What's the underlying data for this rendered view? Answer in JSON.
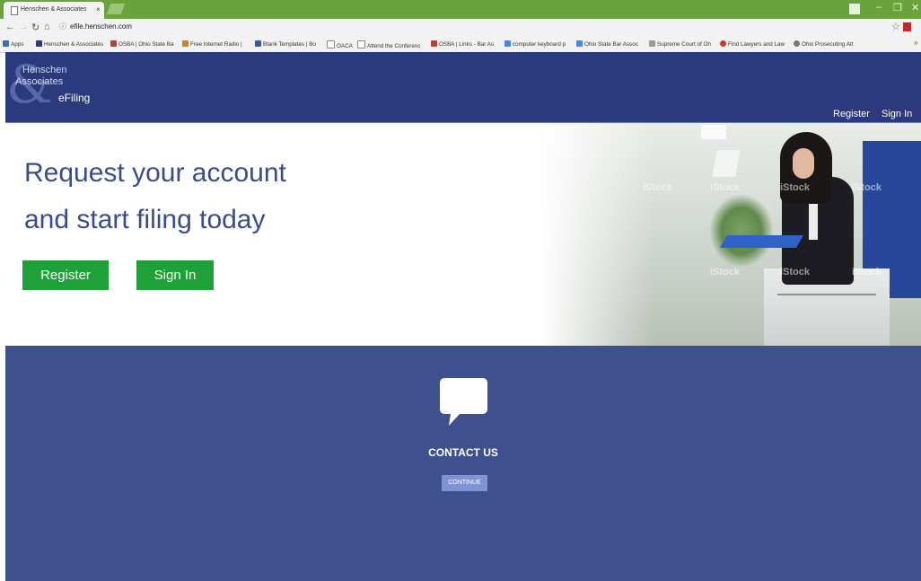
{
  "browser": {
    "tab_title": "Henschen & Associates",
    "tab_close": "×",
    "url": "efile.henschen.com",
    "bookmarks": [
      {
        "label": "Apps",
        "color": "#2d6fd1"
      },
      {
        "label": "Henschen & Associates",
        "color": "#2b3a7c"
      },
      {
        "label": "OSBA | Ohio State Ba",
        "color": "#c23b2f"
      },
      {
        "label": "Free Internet Radio |",
        "color": "#e07b18"
      },
      {
        "label": "Blank Templates | Bo",
        "color": "#3355bb"
      },
      {
        "label": "OACA",
        "color": "#ffffff"
      },
      {
        "label": "Attend the Conferenc",
        "color": "#ffffff"
      },
      {
        "label": "OSBA | Links - Bar As",
        "color": "#c23b2f"
      },
      {
        "label": "computer keyboard p",
        "color": "#4285f4"
      },
      {
        "label": "Ohio State Bar Assoc",
        "color": "#4285f4"
      },
      {
        "label": "Supreme Court of Oh",
        "color": "#9a9a9a"
      },
      {
        "label": "Find Lawyers and Law",
        "color": "#d93025"
      },
      {
        "label": "Ohio Prosecuting Att",
        "color": "#777777"
      }
    ]
  },
  "header": {
    "logo_line1": "Henschen",
    "logo_line2": "Associates",
    "logo_line3": "eFiling",
    "register_link": "Register",
    "signin_link": "Sign In"
  },
  "hero": {
    "title_line1": "Request your account",
    "title_line2": "and start filing today",
    "register_button": "Register",
    "signin_button": "Sign In",
    "watermark": "iStock"
  },
  "contact": {
    "title": "CONTACT US",
    "button": "CONTINUE"
  }
}
